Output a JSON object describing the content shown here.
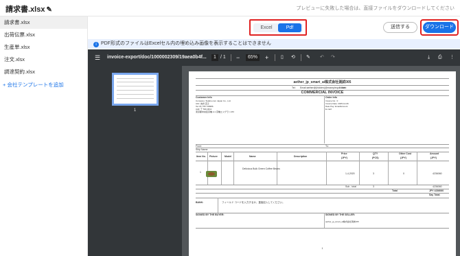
{
  "header": {
    "file_title": "請求書.xlsx",
    "note": "プレビューに失敗した場合は、直接ファイルをダウンロードしてください"
  },
  "sidebar": {
    "items": [
      {
        "label": "請求書.xlsx"
      },
      {
        "label": "出荷伝票.xlsx"
      },
      {
        "label": "生産単.xlsx"
      },
      {
        "label": "注文.xlsx"
      },
      {
        "label": "調達契約.xlsx"
      }
    ],
    "add_label": "+ 会社テンプレートを追加"
  },
  "toolbar": {
    "format_options": [
      "Excel",
      "Pdf"
    ],
    "selected_format": "Pdf",
    "send_label": "送信する",
    "download_label": "ダウンロード"
  },
  "info_bar": {
    "message": "PDF形式のファイルはExcelセル内の埋め込み画像を表示することはできません"
  },
  "pdf_viewer": {
    "menu_icon": "hamburger-icon",
    "filename": "invoice-export/doc/1000002309/19aea0b4f...",
    "page_current": "1",
    "page_total": "/ 1",
    "zoom": "65%",
    "thumb_page_num": "1"
  },
  "invoice": {
    "company": "aether_jp_smart_ai株式会社測試005",
    "tel_label": "Tel:",
    "email": "Email:aether@(hidden)@examplequiltcom",
    "web_label": "Web:",
    "heading": "COMMERCIAL INVOICE",
    "customer_info": "Customer Info",
    "order_info": "Order Info",
    "customer_lines": [
      "Company: SHabu.com Japan Co., Ltd.",
      "Attn: 吉井 直子",
      "Tel: 81 755 738386",
      "Add: 〒 530-0011",
      "東京都中央区京橋 2-1 京橋エドグラン47F"
    ],
    "order_lines": [
      "Invoice No.: 0",
      "Invoice Date: 2025-12-06",
      "Date Pay: EmailAccount",
      "E-mail:"
    ],
    "from_label": "From:",
    "to_label": "To:",
    "ship_name_label": "Ship Name:",
    "columns": [
      "Item No.",
      "Picture",
      "Model",
      "Name",
      "Description",
      "Price",
      "QTY",
      "Other Cost",
      "Amount"
    ],
    "units": [
      "(JPY)",
      "(PCS)",
      "(JPY)",
      "(JPY)"
    ],
    "row": {
      "no": "1",
      "name": "Delicious Bulk Green Coffee Beans",
      "price": "1,4,2020",
      "qty": "3",
      "other": "0",
      "amount": "4236060"
    },
    "subtotal_label": "Sub - total",
    "subtotal_qty": "3",
    "subtotal_amount": "4236060",
    "total_label": "Total",
    "total_value": "JPY 4236060",
    "say_total_label": "Say Total:",
    "bank_label": "BANK:",
    "bank_text": "フィールド コードを入力するか、直接記入してください。",
    "signed_buyer": "SIGNED BY THE BUYER:",
    "signed_seller": "SIGNED BY THE SELLER:",
    "seller_sign": "aether_jp_smart_ai株式会社測試005",
    "page_no": "1"
  }
}
